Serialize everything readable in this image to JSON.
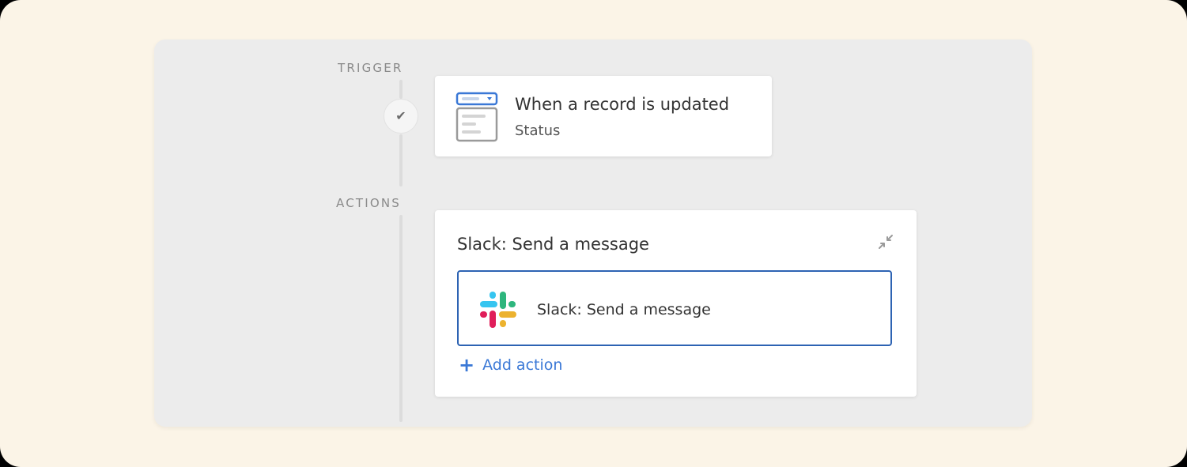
{
  "trigger": {
    "section_label": "TRIGGER",
    "title": "When a record is updated",
    "subtitle": "Status",
    "icon": "record-form-icon"
  },
  "actions": {
    "section_label": "ACTIONS",
    "card_title": "Slack: Send a message",
    "step": {
      "label": "Slack: Send a message",
      "icon": "slack-icon"
    },
    "add_action_label": "Add action"
  },
  "colors": {
    "accent_blue": "#3a78d6",
    "selected_border": "#2d63b3",
    "background": "#fbf4e7",
    "panel": "#ececec"
  }
}
